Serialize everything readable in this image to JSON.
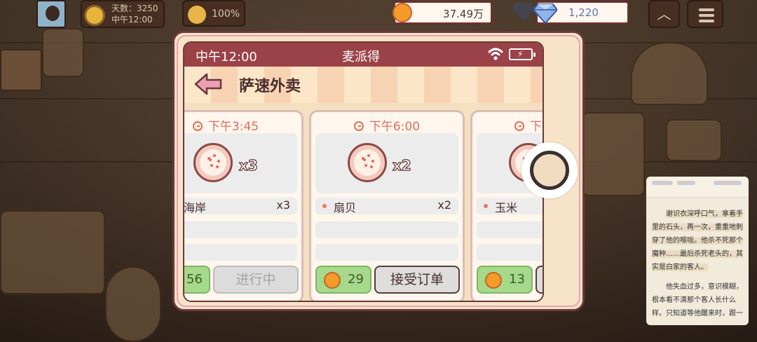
{
  "hud": {
    "day_label": "天数：3250",
    "time_label": "中午12:00",
    "mood_percent": "100%",
    "coins": "37.49万",
    "gems": "1,220"
  },
  "phone": {
    "status_time": "中午12:00",
    "app_name": "麦派得",
    "page_title": "萨速外卖"
  },
  "orders": [
    {
      "time": "下午3:45",
      "dish_qty": "x3",
      "item_name": "典海岸",
      "item_qty": "x3",
      "reward": "56",
      "action": "进行中"
    },
    {
      "time": "下午6:00",
      "dish_qty": "x2",
      "item_name": "扇贝",
      "item_qty": "x2",
      "reward": "29",
      "action": "接受订单"
    },
    {
      "time": "下",
      "item_name": "玉米",
      "reward": "13"
    }
  ],
  "reader": {
    "p1": "谢识衣深呼口气，拿着手里的石头，再一次，重重地刺穿了他的喉咙。他杀不死那个魔种……最后杀死老头的，其实是白家的客人。",
    "p2": "他失血过多，意识模糊，根本看不清那个客人长什么样。只知道等他醒来时，跟一"
  },
  "colors": {
    "status_bar": "#9b4248",
    "accent_pink": "#ec9fb4",
    "time_text": "#e26e5a",
    "reward_green": "#a6d98a",
    "coin": "#f39b2b"
  },
  "icons": [
    "avatar",
    "sun-icon",
    "mood-icon",
    "coin-icon",
    "gem-icon",
    "chevron-up-icon",
    "menu-icon",
    "wifi-icon",
    "battery-icon",
    "back-arrow-icon",
    "clock-icon",
    "pizza-icon"
  ]
}
